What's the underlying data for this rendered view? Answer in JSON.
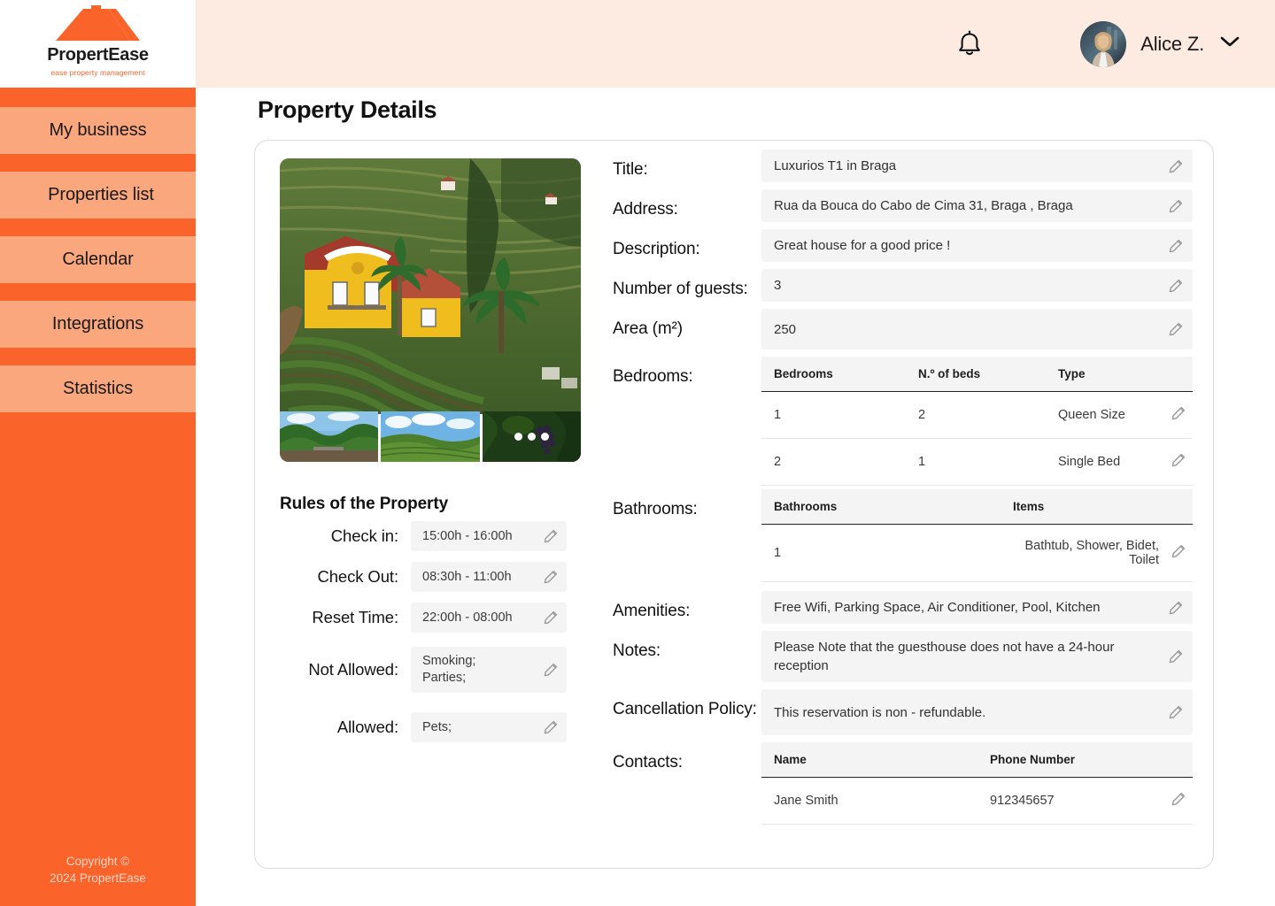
{
  "brand": {
    "name": "PropertEase",
    "tagline": "ease property management",
    "logo_color": "#FA642B"
  },
  "sidebar": {
    "items": [
      {
        "label": "My business",
        "active": false
      },
      {
        "label": "Properties list",
        "active": true
      },
      {
        "label": "Calendar",
        "active": false
      },
      {
        "label": "Integrations",
        "active": false
      },
      {
        "label": "Statistics",
        "active": false
      }
    ],
    "footer_line1": "Copyright ©",
    "footer_line2": "2024 PropertEase",
    "bg_color": "#FA642B",
    "item_color": "#FBA77E"
  },
  "topbar": {
    "notification_icon": "bell-icon",
    "user_name": "Alice Z.",
    "chevron_icon": "chevron-down-icon",
    "bg_color": "#FDEBE2"
  },
  "page": {
    "title": "Property Details"
  },
  "gallery": {
    "main_image_alt": "Yellow villa on terraced vineyard hillside",
    "thumbnails": [
      {
        "alt": "Vineyard rows with pergola"
      },
      {
        "alt": "Green vineyard hillside under clouds"
      },
      {
        "alt": "Grape cluster close-up"
      }
    ],
    "more_indicator": "more-images-dots"
  },
  "rules": {
    "heading": "Rules of the Property",
    "items": [
      {
        "label": "Check in:",
        "value": "15:00h - 16:00h",
        "multiline": false
      },
      {
        "label": "Check Out:",
        "value": "08:30h - 11:00h",
        "multiline": false
      },
      {
        "label": "Reset Time:",
        "value": "22:00h - 08:00h",
        "multiline": false
      },
      {
        "label": "Not Allowed:",
        "value": "Smoking;\nParties;",
        "multiline": true
      },
      {
        "label": "Allowed:",
        "value": "Pets;",
        "multiline": false
      }
    ]
  },
  "details": {
    "title_label": "Title:",
    "title_value": "Luxurios T1 in Braga",
    "address_label": "Address:",
    "address_value": "Rua da Bouca do Cabo de Cima 31, Braga , Braga",
    "description_label": "Description:",
    "description_value": "Great house for a good price !",
    "guests_label": "Number of guests:",
    "guests_value": "3",
    "area_label": "Area (m²)",
    "area_value": "250",
    "bedrooms_label": "Bedrooms:",
    "bathrooms_label": "Bathrooms:",
    "amenities_label": "Amenities:",
    "amenities_value": "Free Wifi, Parking Space, Air Conditioner, Pool, Kitchen",
    "notes_label": "Notes:",
    "notes_value": "Please Note that the guesthouse does not have a 24-hour reception",
    "cancellation_label": "Cancellation Policy:",
    "cancellation_value": "This reservation is non - refundable.",
    "contacts_label": "Contacts:"
  },
  "bedrooms_table": {
    "columns": [
      "Bedrooms",
      "N.º of beds",
      "Type"
    ],
    "rows": [
      {
        "bedroom": "1",
        "beds": "2",
        "type": "Queen Size"
      },
      {
        "bedroom": "2",
        "beds": "1",
        "type": "Single Bed"
      }
    ]
  },
  "bathrooms_table": {
    "columns": [
      "Bathrooms",
      "Items"
    ],
    "rows": [
      {
        "bathroom": "1",
        "items": "Bathtub, Shower, Bidet, Toilet"
      }
    ]
  },
  "contacts_table": {
    "columns": [
      "Name",
      "Phone Number"
    ],
    "rows": [
      {
        "name": "Jane Smith",
        "phone": "912345657"
      }
    ]
  },
  "icons": {
    "edit": "pencil-edit-icon"
  }
}
